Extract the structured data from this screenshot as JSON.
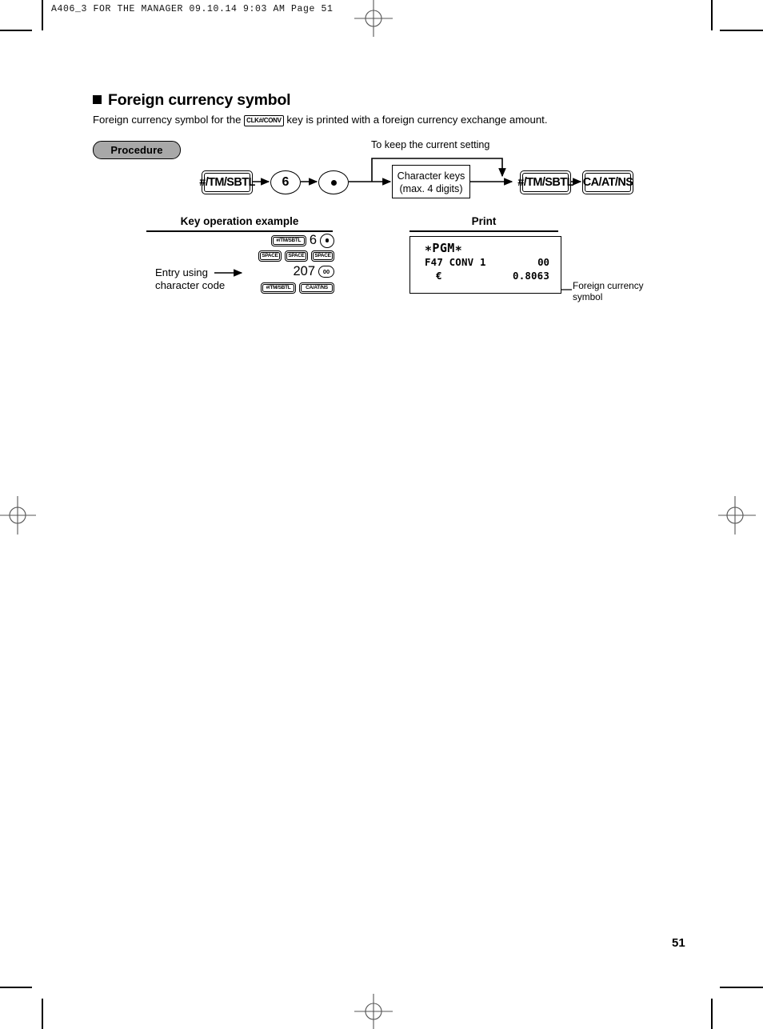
{
  "running_head": "A406_3 FOR THE MANAGER  09.10.14 9:03 AM  Page 51",
  "page_number": "51",
  "section": {
    "title": "Foreign currency symbol",
    "intro_before": "Foreign currency symbol for the",
    "intro_key": "CLK#/CONV",
    "intro_after": "key is printed with a foreign currency exchange amount."
  },
  "procedure": {
    "label": "Procedure",
    "bypass_note": "To keep the current setting",
    "steps": [
      {
        "type": "key",
        "label": "#/TM/SBTL"
      },
      {
        "type": "circle",
        "label": "6"
      },
      {
        "type": "circle-dot",
        "label": "•"
      },
      {
        "type": "box",
        "line1": "Character keys",
        "line2": "(max. 4 digits)"
      },
      {
        "type": "key",
        "label": "#/TM/SBTL"
      },
      {
        "type": "key",
        "label": "CA/AT/NS"
      }
    ]
  },
  "columns": {
    "key_operation_heading": "Key operation example",
    "print_heading": "Print"
  },
  "key_operation": {
    "annotation_line1": "Entry using",
    "annotation_line2": "character code",
    "rows": [
      [
        "#/TM/SBTL",
        "6",
        "•"
      ],
      [
        "SPACE",
        "SPACE",
        "SPACE"
      ],
      [
        "207",
        "00"
      ],
      [
        "#/TM/SBTL",
        "CA/AT/NS"
      ]
    ],
    "row1_key": "#/TM/SBTL",
    "row1_num": "6",
    "row2_key": "SPACE",
    "row3_num": "207",
    "row3_key": "00",
    "row4_key1": "#/TM/SBTL",
    "row4_key2": "CA/AT/NS"
  },
  "print_sample": {
    "header": "∗PGM∗",
    "line2_label": "F47 CONV 1",
    "line2_value": "00",
    "line3_label": "€",
    "line3_value": "0.8063",
    "callout_line1": "Foreign currency",
    "callout_line2": "symbol"
  }
}
